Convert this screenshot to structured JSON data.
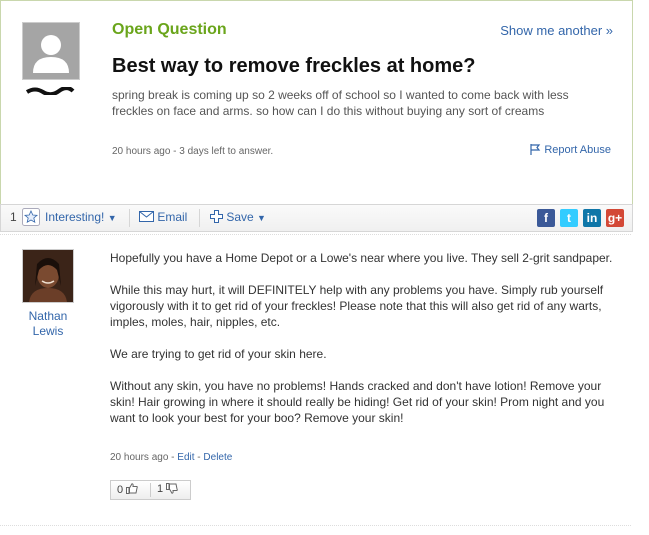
{
  "question": {
    "status": "Open Question",
    "show_another": "Show me another »",
    "title": "Best way to remove freckles at home?",
    "description": "spring break is coming up so 2 weeks off of school so I wanted to come back with less freckles on face and arms. so how can I do this without buying any sort of creams",
    "meta": "20 hours ago - 3 days left to answer.",
    "report": "Report Abuse"
  },
  "toolbar": {
    "interesting_count": "1",
    "interesting_label": "Interesting!",
    "email_label": "Email",
    "save_label": "Save",
    "social": [
      {
        "icon": "facebook-icon",
        "glyph": "f",
        "color": "#3b5998"
      },
      {
        "icon": "twitter-icon",
        "glyph": "t",
        "color": "#33ccff"
      },
      {
        "icon": "linkedin-icon",
        "glyph": "in",
        "color": "#0e76a8"
      },
      {
        "icon": "googleplus-icon",
        "glyph": "g+",
        "color": "#d34836"
      }
    ]
  },
  "answer": {
    "user_first": "Nathan",
    "user_last": "Lewis",
    "paragraphs": [
      "Hopefully you have a Home Depot or a Lowe's near where you live. They sell 2-grit sandpaper.",
      "While this may hurt, it will DEFINITELY help with any problems you have. Simply rub yourself vigorously with it to get rid of your freckles! Please note that this will also get rid of any warts, imples, moles, hair, nipples, etc.",
      "We are trying to get rid of your skin here.",
      "Without any skin, you have no problems! Hands cracked and don't have lotion! Remove your skin! Hair growing in where it should really be hiding! Get rid of your skin! Prom night and you want to look your best for your boo? Remove your skin!"
    ],
    "time": "20 hours ago",
    "edit_label": "Edit",
    "delete_label": "Delete",
    "thumbs_up": "0",
    "thumbs_down": "1"
  }
}
